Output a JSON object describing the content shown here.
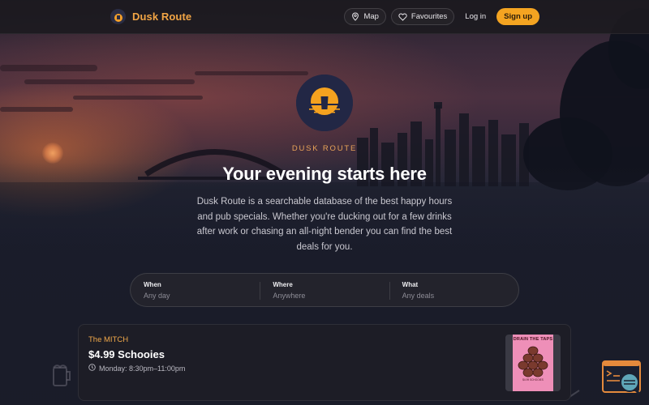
{
  "header": {
    "brand_name": "Dusk Route",
    "nav": {
      "map_label": "Map",
      "favourites_label": "Favourites",
      "login_label": "Log in",
      "signup_label": "Sign up"
    }
  },
  "hero": {
    "tagline": "DUSK ROUTE",
    "title": "Your evening starts here",
    "description": "Dusk Route is a searchable database of the best happy hours and pub specials. Whether you're ducking out for a few drinks after work or chasing an all-night bender you can find the best deals for you."
  },
  "search": {
    "when": {
      "label": "When",
      "value": "Any day"
    },
    "where": {
      "label": "Where",
      "value": "Anywhere"
    },
    "what": {
      "label": "What",
      "value": "Any deals"
    }
  },
  "deals": [
    {
      "venue": "The MITCH",
      "title": "$4.99 Schooies",
      "time": "Monday: 8:30pm–11:00pm",
      "poster": {
        "headline": "DRAIN THE TAPS",
        "subline": "$4.99 SCHOOIES"
      }
    }
  ],
  "colors": {
    "accent": "#f4a421",
    "brand_text": "#f2a545",
    "background": "#1a1c29"
  },
  "icons": {
    "map": "map-pin-icon",
    "favourites": "heart-icon",
    "time": "clock-icon",
    "help": "support-icon"
  }
}
